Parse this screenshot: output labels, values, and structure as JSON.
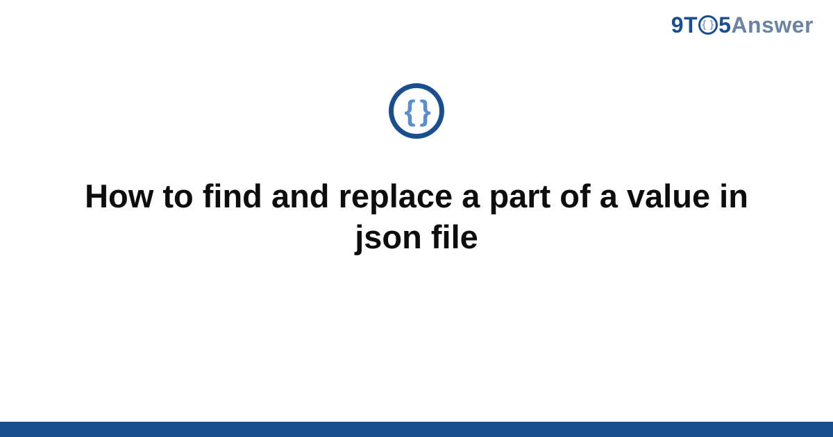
{
  "brand": {
    "part1": "9T",
    "o_inner": "{ }",
    "part2": "5",
    "part3": "Answer"
  },
  "badge": {
    "glyph": "{ }",
    "name": "json-braces-icon"
  },
  "title": "How to find and replace a part of a value in json file",
  "colors": {
    "brand_primary": "#1a4f8f",
    "brand_secondary": "#6b84a3",
    "brace_blue": "#5a8ecf",
    "text": "#0d0d0d",
    "footer": "#1a4f8f"
  }
}
